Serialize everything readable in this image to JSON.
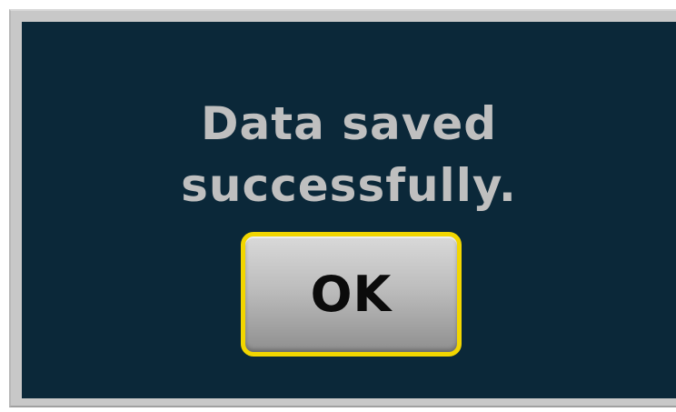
{
  "dialog": {
    "message_line_1": "Data saved",
    "message_line_2": "successfully.",
    "ok_label": "OK"
  },
  "colors": {
    "dialog_background": "#0b2839",
    "message_text": "#bfbfbf",
    "button_border": "#f2d600",
    "button_text": "#0b0b0b"
  }
}
